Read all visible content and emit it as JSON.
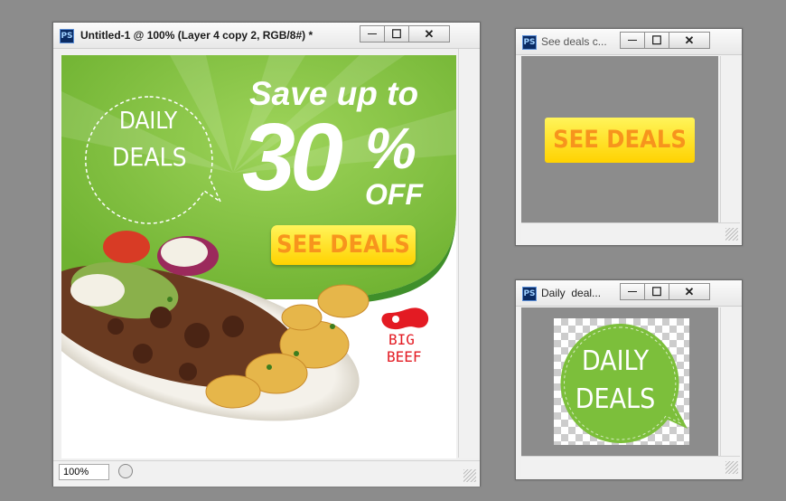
{
  "main_window": {
    "app_icon": "PS",
    "title": "Untitled-1 @ 100% (Layer 4 copy 2, RGB/8#) *",
    "zoom": "100%",
    "canvas": {
      "bubble_line1": "DAILY",
      "bubble_line2": "DEALS",
      "headline": "Save up to",
      "big_number": "30",
      "percent_sign": "%",
      "off_text": "OFF",
      "cta": "SEE DEALS",
      "brand_line1": "BIG",
      "brand_line2": "BEEF",
      "food_image": "plate of gyro meat, potatoes and salad"
    }
  },
  "see_deals_window": {
    "app_icon": "PS",
    "title": "See deals c...",
    "cta": "SEE DEALS"
  },
  "daily_deals_window": {
    "app_icon": "PS",
    "title": "Daily  deal...",
    "bubble_line1": "DAILY",
    "bubble_line2": "DEALS"
  },
  "window_controls": {
    "minimize": "—",
    "maximize": "☐",
    "close": "✕"
  },
  "colors": {
    "green": "#7cbf3b",
    "yellow": "#ffe600",
    "orange_text": "#f7941d",
    "brand_red": "#e31b23",
    "workspace": "#8c8c8c"
  }
}
